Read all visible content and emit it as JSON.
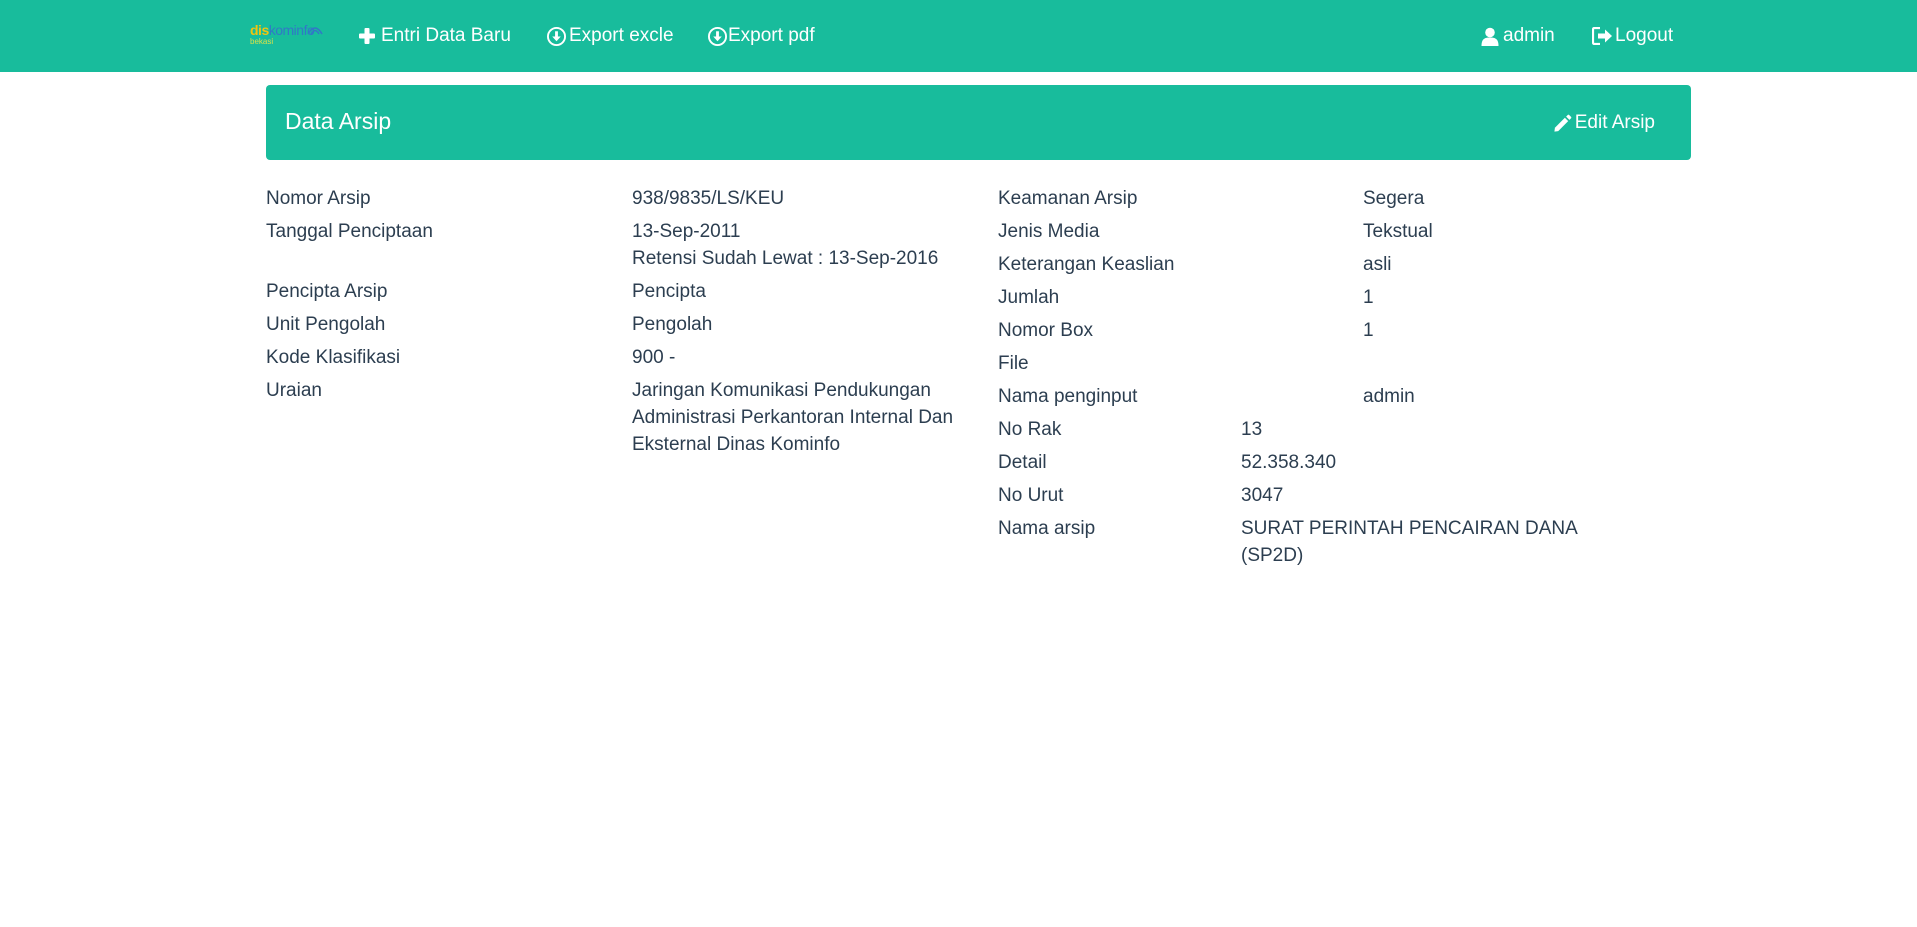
{
  "navbar": {
    "brand": {
      "part1": "dis",
      "part2": "kominfo",
      "subtitle": "bekasi"
    },
    "entri_label": "Entri Data Baru",
    "export_excle_label": "Export excle",
    "export_pdf_label": "Export pdf",
    "user_label": "admin",
    "logout_label": "Logout"
  },
  "panel": {
    "title": "Data Arsip",
    "edit_label": "Edit Arsip"
  },
  "left_fields": [
    {
      "label": "Nomor Arsip",
      "value": "938/9835/LS/KEU"
    },
    {
      "label": "Tanggal Penciptaan",
      "value": "13-Sep-2011",
      "note": "Retensi Sudah Lewat : 13-Sep-2016"
    },
    {
      "label": "Pencipta Arsip",
      "value": "Pencipta"
    },
    {
      "label": "Unit Pengolah",
      "value": "Pengolah"
    },
    {
      "label": "Kode Klasifikasi",
      "value": "900 -"
    },
    {
      "label": "Uraian",
      "value": "Jaringan Komunikasi Pendukungan Administrasi Perkantoran Internal Dan Eksternal Dinas Kominfo"
    }
  ],
  "right_fields": [
    {
      "label": "Keamanan Arsip",
      "value": "Segera"
    },
    {
      "label": "Jenis Media",
      "value": "Tekstual"
    },
    {
      "label": "Keterangan Keaslian",
      "value": "asli"
    },
    {
      "label": "Jumlah",
      "value": "1"
    },
    {
      "label": "Nomor Box",
      "value": "1"
    },
    {
      "label": "File",
      "value": ""
    },
    {
      "label": "Nama penginput",
      "value": "admin"
    },
    {
      "label": "No Rak",
      "value": "13"
    },
    {
      "label": "Detail",
      "value": "52.358.340"
    },
    {
      "label": "No Urut",
      "value": "3047"
    },
    {
      "label": "Nama arsip",
      "value": "SURAT PERINTAH PENCAIRAN DANA (SP2D)"
    }
  ],
  "colors": {
    "accent": "#18bc9c",
    "text": "#2c3e50"
  }
}
